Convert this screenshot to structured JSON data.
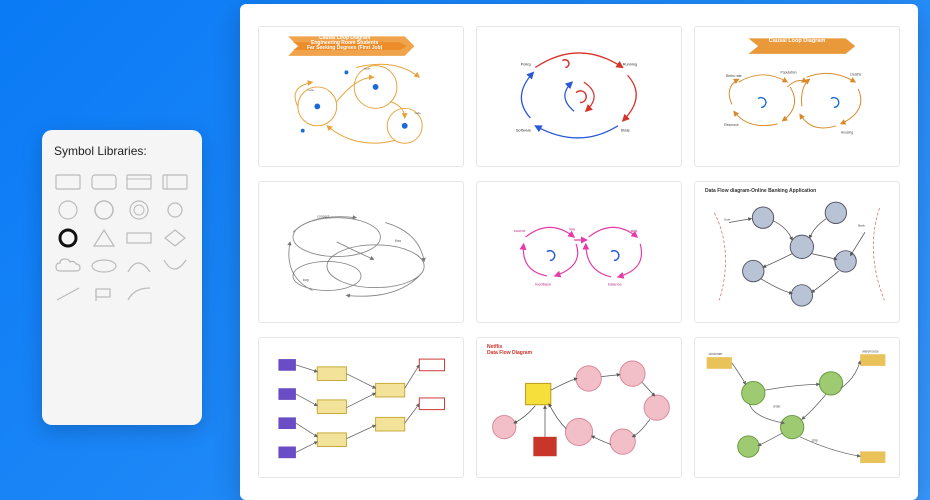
{
  "panel": {
    "title": "Symbol Libraries:"
  },
  "symbols": [
    {
      "name": "rect-thin"
    },
    {
      "name": "rect-rounded"
    },
    {
      "name": "rect-header"
    },
    {
      "name": "rect-double"
    },
    {
      "name": "circle-thin"
    },
    {
      "name": "circle-med"
    },
    {
      "name": "circle-open"
    },
    {
      "name": "circle-small"
    },
    {
      "name": "circle-bold"
    },
    {
      "name": "triangle"
    },
    {
      "name": "rect-outline"
    },
    {
      "name": "diamond"
    },
    {
      "name": "cloud"
    },
    {
      "name": "ellipse"
    },
    {
      "name": "arc-right"
    },
    {
      "name": "arc-left"
    },
    {
      "name": "line"
    },
    {
      "name": "flag"
    },
    {
      "name": "curve"
    },
    {
      "name": "blank"
    }
  ],
  "templates": [
    {
      "id": "t1",
      "title_a": "Causal Loop Diagram",
      "title_b": "Engineering Room Students",
      "title_c": "Far Seeking Degrees (First Job)",
      "kind": "causal-loop-orange"
    },
    {
      "id": "t2",
      "title": "",
      "kind": "causal-loop-redblue"
    },
    {
      "id": "t3",
      "title": "Causal Loop Diagram",
      "kind": "causal-loop-ribbon"
    },
    {
      "id": "t4",
      "title": "",
      "kind": "flow-sketch"
    },
    {
      "id": "t5",
      "title": "",
      "kind": "loop-magenta"
    },
    {
      "id": "t6",
      "title": "Data Flow diagram-Online Banking Application",
      "kind": "dfd-online-banking"
    },
    {
      "id": "t7",
      "title": "",
      "kind": "dfd-purple"
    },
    {
      "id": "t8",
      "title": "Netflix",
      "subtitle": "Data Flow Diagram",
      "kind": "dfd-netflix"
    },
    {
      "id": "t9",
      "title": "",
      "kind": "dfd-green"
    }
  ]
}
